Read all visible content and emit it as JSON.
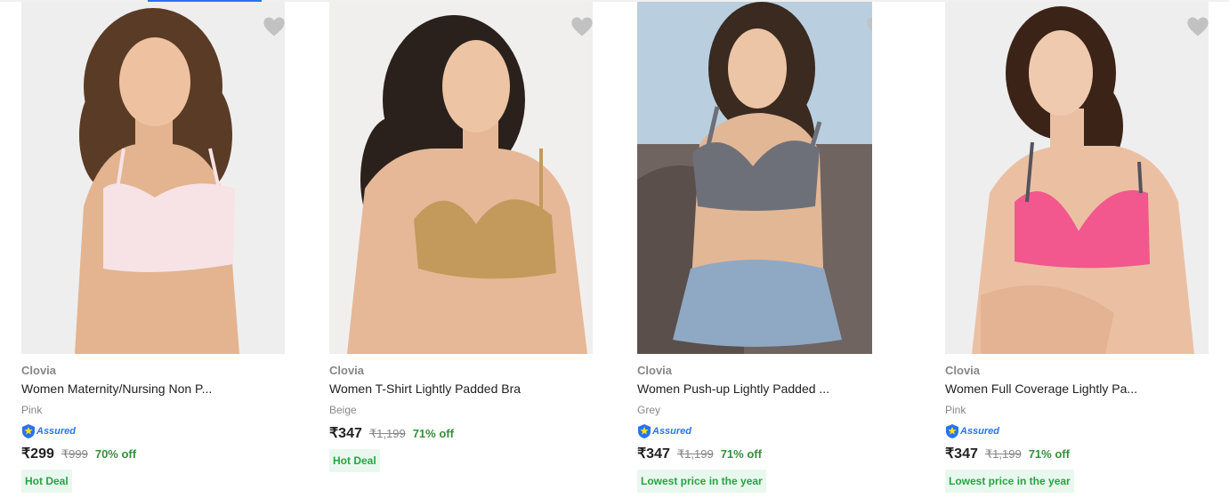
{
  "colors": {
    "accent": "#2874f0",
    "discount": "#388e3c",
    "badge_bg": "#e9f8ee",
    "badge_text": "#26a541",
    "brand_text": "#878787"
  },
  "products": [
    {
      "brand": "Clovia",
      "title": "Women Maternity/Nursing Non P...",
      "color": "Pink",
      "assured": true,
      "assured_label": "Assured",
      "price": "₹299",
      "mrp": "₹999",
      "discount": "70% off",
      "badge": "Hot Deal",
      "image_icon": "model-pink-bra-image",
      "wishlist_icon": "heart-icon"
    },
    {
      "brand": "Clovia",
      "title": "Women T-Shirt Lightly Padded Bra",
      "color": "Beige",
      "assured": false,
      "price": "₹347",
      "mrp": "₹1,199",
      "discount": "71% off",
      "badge": "Hot Deal",
      "image_icon": "model-beige-bra-image",
      "wishlist_icon": "heart-icon"
    },
    {
      "brand": "Clovia",
      "title": "Women Push-up Lightly Padded ...",
      "color": "Grey",
      "assured": true,
      "assured_label": "Assured",
      "price": "₹347",
      "mrp": "₹1,199",
      "discount": "71% off",
      "badge": "Lowest price in the year",
      "image_icon": "model-grey-bra-image",
      "wishlist_icon": "heart-icon"
    },
    {
      "brand": "Clovia",
      "title": "Women Full Coverage Lightly Pa...",
      "color": "Pink",
      "assured": true,
      "assured_label": "Assured",
      "price": "₹347",
      "mrp": "₹1,199",
      "discount": "71% off",
      "badge": "Lowest price in the year",
      "image_icon": "model-hot-pink-bra-image",
      "wishlist_icon": "heart-icon"
    }
  ]
}
